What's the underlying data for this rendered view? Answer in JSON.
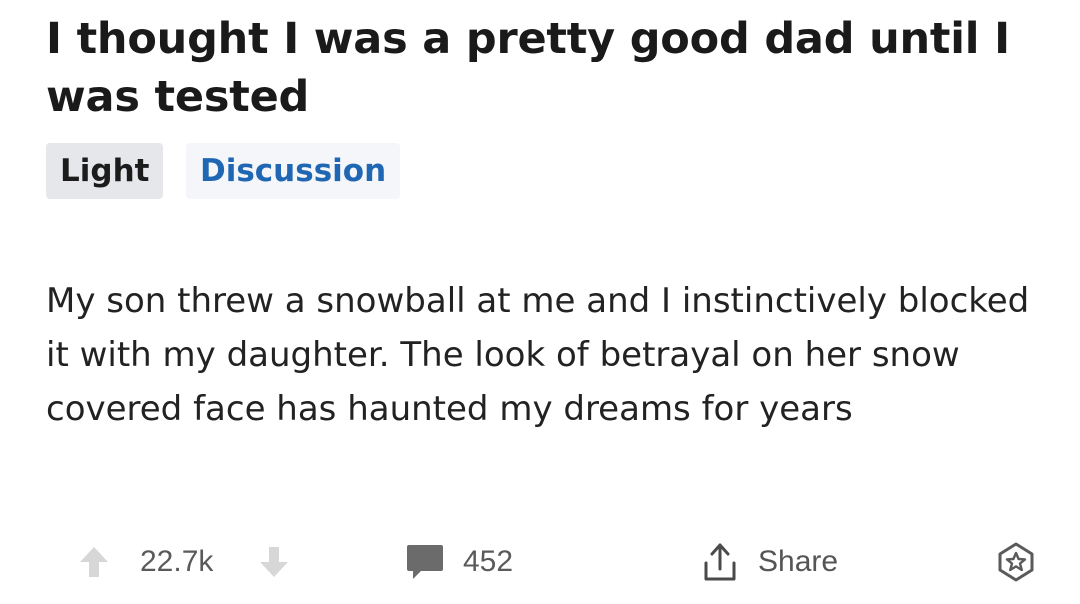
{
  "post": {
    "title": "I thought I was a pretty good dad until I was tested",
    "flairs": [
      "Light",
      "Discussion"
    ],
    "body": "My son threw a snowball at me and I instinctively blocked it with my daughter. The look of betrayal on her snow covered face has haunted my dreams for years"
  },
  "actions": {
    "score": "22.7k",
    "comments": "452",
    "share_label": "Share"
  },
  "icons": {
    "upvote": "upvote-arrow-icon",
    "downvote": "downvote-arrow-icon",
    "comment": "comment-bubble-icon",
    "share": "share-icon",
    "award": "award-icon"
  },
  "colors": {
    "flair_discussion_text": "#1f67b3",
    "vote_arrow": "#d7d7d7"
  }
}
